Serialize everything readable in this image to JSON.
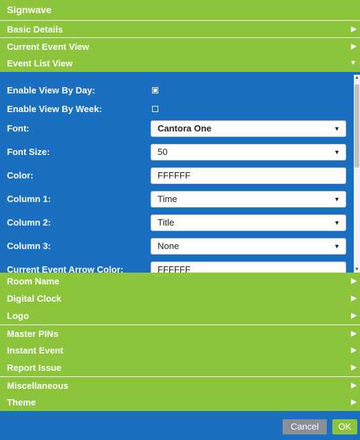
{
  "app": {
    "title": "Signwave"
  },
  "sections_top": [
    {
      "label": "Basic Details",
      "arrow": "▶"
    },
    {
      "label": "Current Event View",
      "arrow": "▶"
    },
    {
      "label": "Event List View",
      "arrow": "▼"
    }
  ],
  "event_list_view": {
    "enable_by_day": {
      "label": "Enable View By Day:",
      "checked": true
    },
    "enable_by_week": {
      "label": "Enable View By Week:",
      "checked": false
    },
    "font": {
      "label": "Font:",
      "value": "Cantora One",
      "caret": "▼"
    },
    "font_size": {
      "label": "Font Size:",
      "value": "50",
      "caret": "▼"
    },
    "color": {
      "label": "Color:",
      "value": "FFFFFF"
    },
    "column1": {
      "label": "Column 1:",
      "value": "Time",
      "caret": "▼"
    },
    "column2": {
      "label": "Column 2:",
      "value": "Title",
      "caret": "▼"
    },
    "column3": {
      "label": "Column 3:",
      "value": "None",
      "caret": "▼"
    },
    "arrow_color": {
      "label": "Current Event Arrow Color:",
      "value": "FFFFFF"
    }
  },
  "sections_bottom": [
    {
      "label": "Room Name",
      "arrow": "▶"
    },
    {
      "label": "Digital Clock",
      "arrow": "▶"
    },
    {
      "label": "Logo",
      "arrow": "▶"
    },
    {
      "label": "Master PINs",
      "arrow": "▶"
    },
    {
      "label": "Instant Event",
      "arrow": "▶"
    },
    {
      "label": "Report Issue",
      "arrow": "▶"
    },
    {
      "label": "Miscellaneous",
      "arrow": "▶"
    },
    {
      "label": "Theme",
      "arrow": "▶"
    }
  ],
  "footer": {
    "cancel_label": "Cancel",
    "ok_label": "OK"
  },
  "colors": {
    "green": "#8cc43c",
    "blue": "#1a6fc0",
    "white": "#ffffff",
    "gray_button": "#8a8f96"
  }
}
